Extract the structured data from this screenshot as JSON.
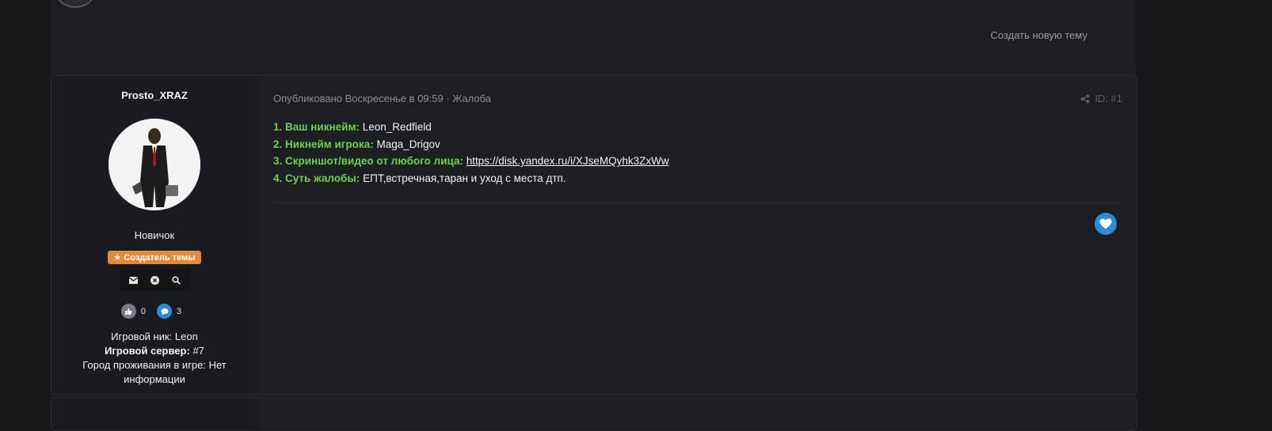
{
  "header": {
    "new_topic_label": "Создать новую тему"
  },
  "post": {
    "author": {
      "name": "Prosto_XRAZ",
      "rank": "Новичок",
      "badge": "Создатель темы",
      "reactions_count": "0",
      "messages_count": "3",
      "game_nick_label": "Игровой ник:",
      "game_nick": "Leon",
      "server_label": "Игровой сервер:",
      "server": "#7",
      "city_label": "Город проживания в игре:",
      "city": "Нет информации"
    },
    "meta": {
      "published": "Опубликовано Воскресенье в 09:59",
      "separator": " · ",
      "complaint": "Жалоба"
    },
    "post_id": "ID: #1",
    "lines": [
      {
        "label": "1. Ваш никнейм:",
        "value": "Leon_Redfield"
      },
      {
        "label": "2. Никнейм игрока:",
        "value": "Maga_Drigov"
      },
      {
        "label": "3. Скриншот/видео от любого лица:",
        "value": "https://disk.yandex.ru/i/XJseMQyhk3ZxWw"
      },
      {
        "label": "4. Суть жалобы:",
        "value": "ЕПТ,встречная,таран и уход с места дтп."
      }
    ]
  },
  "colors": {
    "accent_green": "#6fcf4b",
    "badge_orange": "#e8883a",
    "like_blue": "#2f8bd0"
  }
}
